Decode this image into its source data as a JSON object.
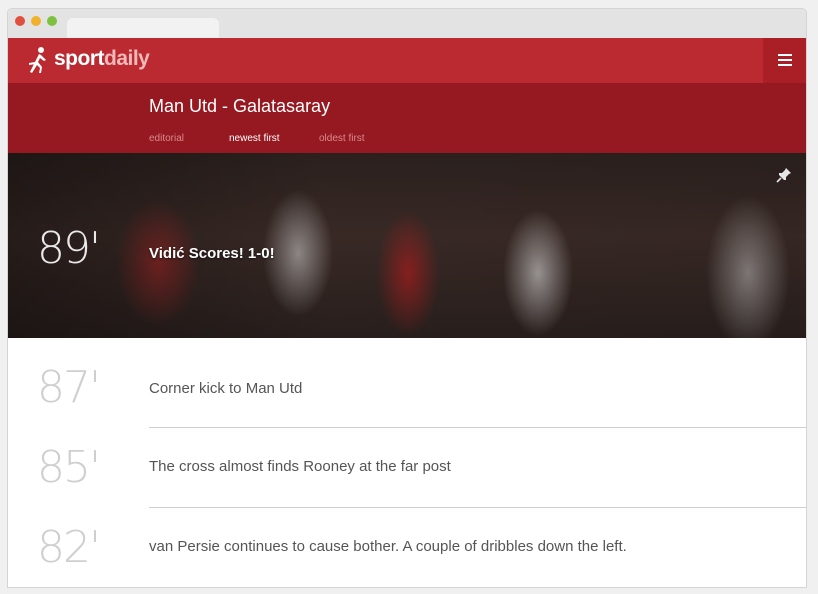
{
  "brand": {
    "name_bold": "sport",
    "name_light": "daily"
  },
  "match": {
    "title": "Man Utd - Galatasaray"
  },
  "sort_tabs": [
    {
      "label": "editorial",
      "active": false
    },
    {
      "label": "newest first",
      "active": true
    },
    {
      "label": "oldest first",
      "active": false
    }
  ],
  "featured": {
    "minute": "89'",
    "text": "Vidić Scores! 1-0!"
  },
  "events": [
    {
      "minute": "87'",
      "text": "Corner kick to Man Utd"
    },
    {
      "minute": "85'",
      "text": "The cross almost finds Rooney at the far post"
    },
    {
      "minute": "82'",
      "text": "van Persie continues to cause bother. A couple of dribbles down the left."
    }
  ],
  "colors": {
    "topbar": "#bc2a31",
    "subheader": "#961820",
    "menu_button": "#a91f25"
  },
  "icons": [
    "runner-logo-icon",
    "hamburger-menu-icon",
    "pin-icon"
  ]
}
